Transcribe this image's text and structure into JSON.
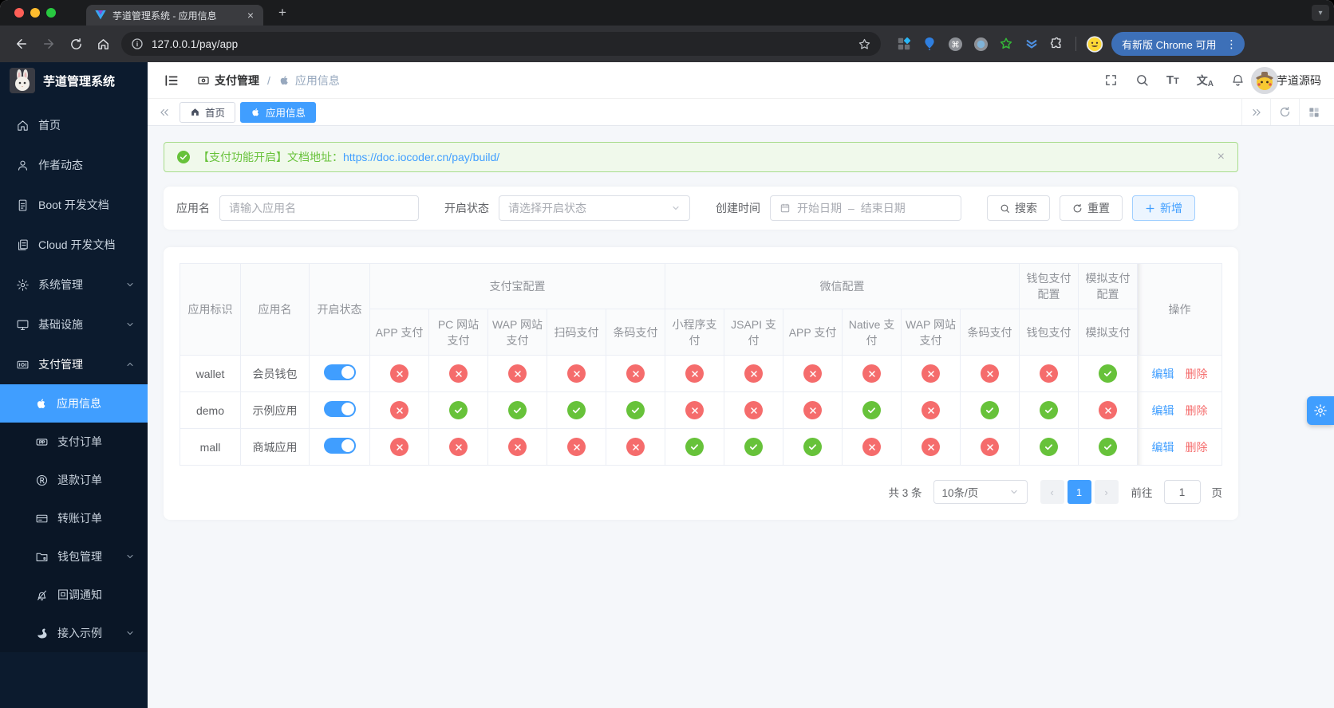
{
  "browser": {
    "tab_title": "芋道管理系统 - 应用信息",
    "url": "127.0.0.1/pay/app",
    "update_label": "有新版 Chrome 可用",
    "extensions": [
      "squares-icon",
      "balloon-icon",
      "command-icon",
      "dot-circle-icon",
      "star-green-icon",
      "chevrons-icon",
      "puzzle-icon"
    ]
  },
  "sidebar": {
    "title": "芋道管理系统",
    "items": [
      {
        "key": "home",
        "label": "首页",
        "icon": "home"
      },
      {
        "key": "author",
        "label": "作者动态",
        "icon": "user"
      },
      {
        "key": "boot-doc",
        "label": "Boot 开发文档",
        "icon": "doc"
      },
      {
        "key": "cloud-doc",
        "label": "Cloud 开发文档",
        "icon": "docs"
      },
      {
        "key": "system",
        "label": "系统管理",
        "icon": "gear",
        "arrow": "down"
      },
      {
        "key": "infra",
        "label": "基础设施",
        "icon": "monitor",
        "arrow": "down"
      },
      {
        "key": "pay",
        "label": "支付管理",
        "icon": "money",
        "arrow": "up",
        "expanded": true
      }
    ],
    "subitems": [
      {
        "key": "app-info",
        "label": "应用信息",
        "icon": "apple",
        "active": true
      },
      {
        "key": "pay-order",
        "label": "支付订单",
        "icon": "paypal"
      },
      {
        "key": "refund-order",
        "label": "退款订单",
        "icon": "registered"
      },
      {
        "key": "transfer-order",
        "label": "转账订单",
        "icon": "card"
      },
      {
        "key": "wallet-mgr",
        "label": "钱包管理",
        "icon": "folder",
        "arrow": "down"
      },
      {
        "key": "callback",
        "label": "回调通知",
        "icon": "notify"
      },
      {
        "key": "demo-entry",
        "label": "接入示例",
        "icon": "swan",
        "arrow": "down"
      }
    ]
  },
  "header": {
    "breadcrumb": {
      "parent": "支付管理",
      "current": "应用信息"
    },
    "actions": [
      "fullscreen-icon",
      "search-icon",
      "font-size-icon",
      "locale-icon",
      "bell-icon"
    ],
    "username": "芋道源码"
  },
  "tabs": {
    "items": [
      {
        "label": "首页"
      },
      {
        "label": "应用信息",
        "active": true
      }
    ]
  },
  "alert": {
    "prefix": "【支付功能开启】文档地址：",
    "link": "https://doc.iocoder.cn/pay/build/"
  },
  "filters": {
    "app_name_label": "应用名",
    "app_name_placeholder": "请输入应用名",
    "status_label": "开启状态",
    "status_placeholder": "请选择开启状态",
    "date_label": "创建时间",
    "date_start": "开始日期",
    "date_separator": "–",
    "date_end": "结束日期",
    "search_label": "搜索",
    "reset_label": "重置",
    "add_label": "新增"
  },
  "table": {
    "col_app_id": "应用标识",
    "col_app_name": "应用名",
    "col_status": "开启状态",
    "groups": [
      {
        "label": "支付宝配置",
        "cols": [
          "APP 支付",
          "PC 网站支付",
          "WAP 网站支付",
          "扫码支付",
          "条码支付"
        ]
      },
      {
        "label": "微信配置",
        "cols": [
          "小程序支付",
          "JSAPI 支付",
          "APP 支付",
          "Native 支付",
          "WAP 网站支付",
          "条码支付"
        ]
      },
      {
        "label": "钱包支付配置",
        "cols": [
          "钱包支付"
        ]
      },
      {
        "label": "模拟支付配置",
        "cols": [
          "模拟支付"
        ]
      }
    ],
    "col_actions": "操作",
    "edit_label": "编辑",
    "delete_label": "删除",
    "rows": [
      {
        "id": "wallet",
        "name": "会员钱包",
        "enabled": true,
        "channels": [
          0,
          0,
          0,
          0,
          0,
          0,
          0,
          0,
          0,
          0,
          0,
          0,
          1
        ]
      },
      {
        "id": "demo",
        "name": "示例应用",
        "enabled": true,
        "channels": [
          0,
          1,
          1,
          1,
          1,
          0,
          0,
          0,
          1,
          0,
          1,
          1,
          0
        ]
      },
      {
        "id": "mall",
        "name": "商城应用",
        "enabled": true,
        "channels": [
          0,
          0,
          0,
          0,
          0,
          1,
          1,
          1,
          0,
          0,
          0,
          1,
          1
        ]
      }
    ]
  },
  "pagination": {
    "total": "共 3 条",
    "page_size": "10条/页",
    "page": "1",
    "goto_label": "前往",
    "page_unit": "页"
  },
  "colors": {
    "primary": "#409eff",
    "success": "#67c23a",
    "danger": "#f56c6c"
  }
}
